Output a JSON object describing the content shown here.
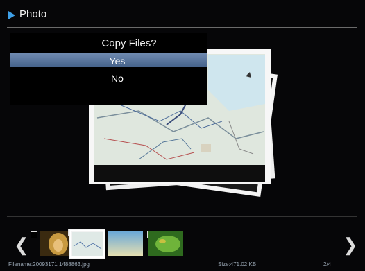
{
  "header": {
    "title": "Photo"
  },
  "dialog": {
    "title": "Copy Files?",
    "options": [
      "Yes",
      "No"
    ],
    "selected": "Yes"
  },
  "thumbnails": [
    {
      "name": "lion",
      "checked": false,
      "selected": false
    },
    {
      "name": "map",
      "checked": true,
      "selected": true
    },
    {
      "name": "sky",
      "checked": false,
      "selected": false
    },
    {
      "name": "leaf",
      "checked": true,
      "selected": false
    }
  ],
  "status": {
    "filename": "Filename:20093171 1488863.jpg",
    "size": "Size:471.02 KB",
    "page": "2/4"
  },
  "colors": {
    "accent": "#3ea0e8",
    "selection": "#5a76a0"
  }
}
